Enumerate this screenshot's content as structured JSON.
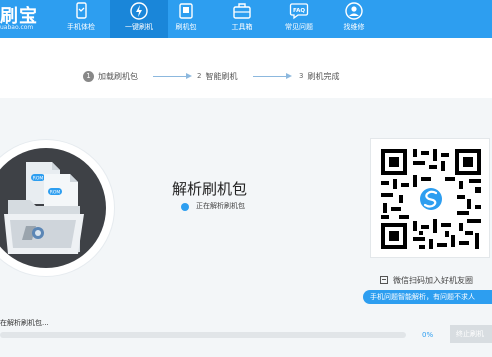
{
  "brand": {
    "name": "刷宝",
    "url": "uabao.com"
  },
  "nav": [
    {
      "label": "手机体检",
      "icon": "phone-check-icon",
      "active": false
    },
    {
      "label": "一键刷机",
      "icon": "lightning-icon",
      "active": true
    },
    {
      "label": "刷机包",
      "icon": "rom-package-icon",
      "active": false
    },
    {
      "label": "工具箱",
      "icon": "toolbox-icon",
      "active": false
    },
    {
      "label": "常见问题",
      "icon": "faq-icon",
      "active": false
    },
    {
      "label": "找维修",
      "icon": "repair-person-icon",
      "active": false
    }
  ],
  "steps": [
    {
      "num": "1",
      "label": "加载刷机包"
    },
    {
      "num": "2",
      "label": "智能刷机"
    },
    {
      "num": "3",
      "label": "刷机完成"
    }
  ],
  "main": {
    "title": "解析刷机包",
    "status": "正在解析刷机包"
  },
  "illustration": {
    "badge_text": "ROM"
  },
  "qr": {
    "caption": "微信扫码加入好机友圈",
    "tip": "手机问题智能解析，有问题不求人"
  },
  "progress": {
    "label": "在解析刷机包...",
    "percent_text": "0%",
    "value": 0
  },
  "buttons": {
    "stop": "终止刷机"
  },
  "colors": {
    "accent": "#2d9ef0",
    "nav_active": "#1a86d9"
  }
}
